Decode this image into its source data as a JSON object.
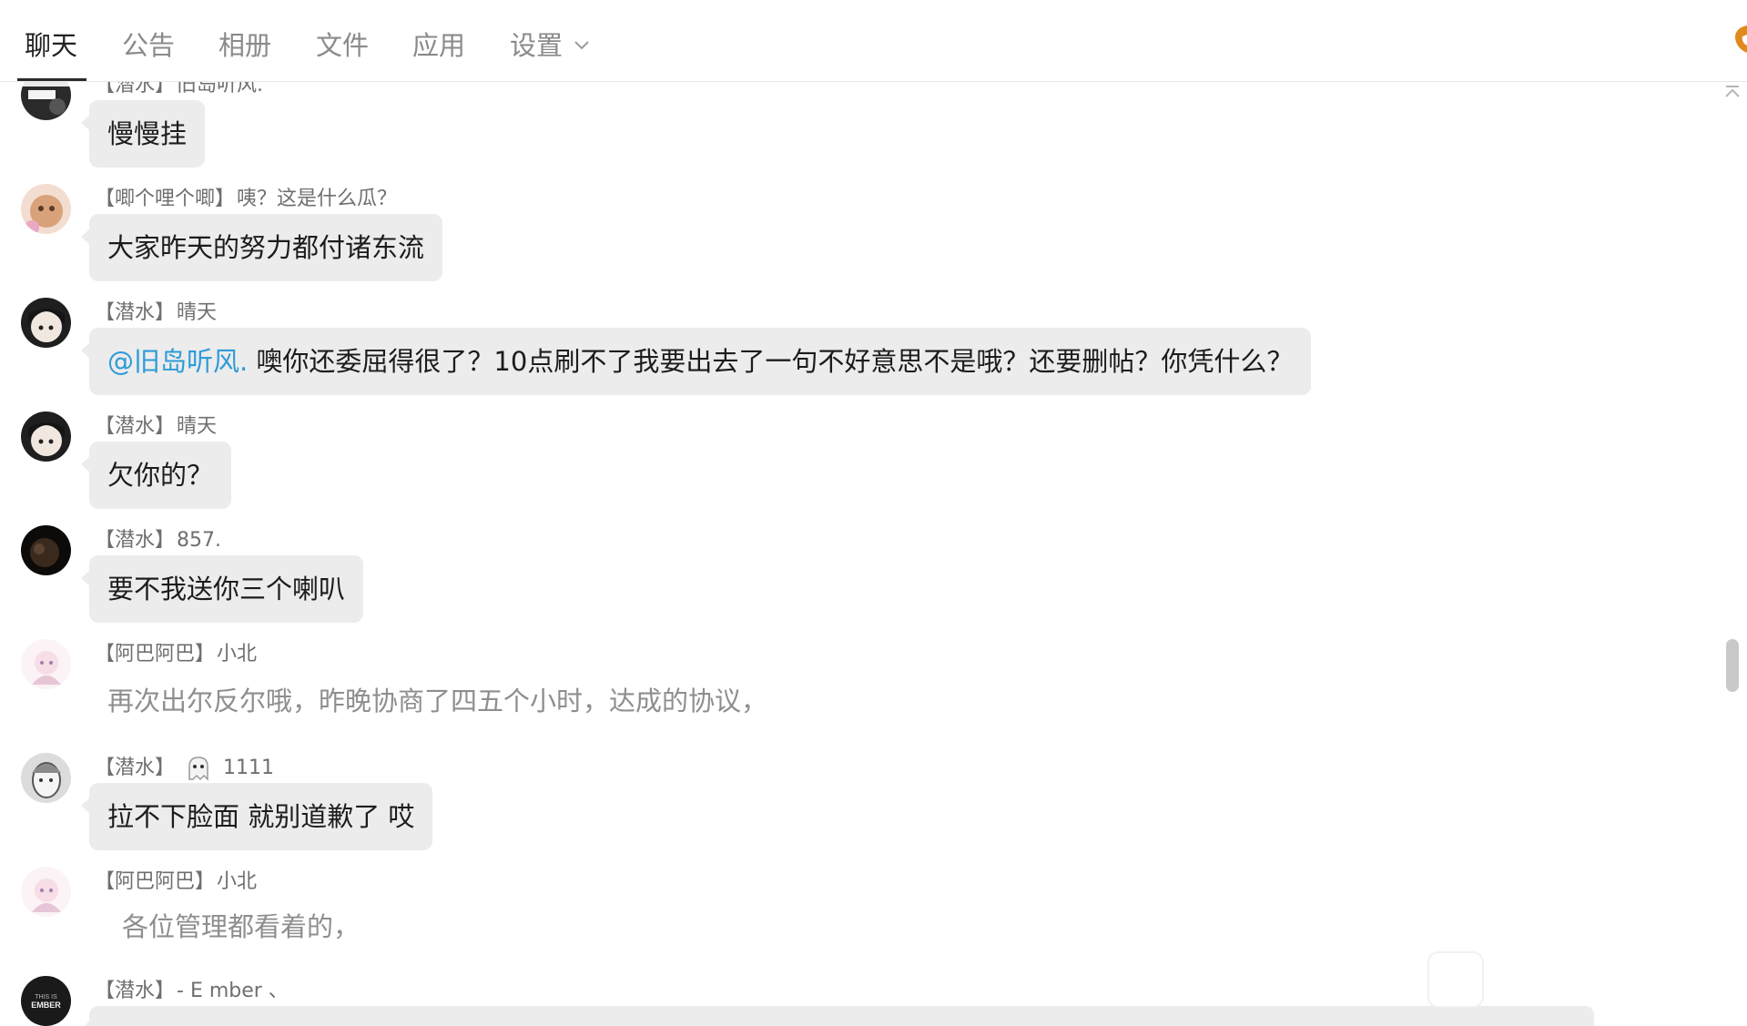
{
  "tabs": [
    {
      "label": "聊天",
      "active": true
    },
    {
      "label": "公告",
      "active": false
    },
    {
      "label": "相册",
      "active": false
    },
    {
      "label": "文件",
      "active": false
    },
    {
      "label": "应用",
      "active": false
    },
    {
      "label": "设置",
      "active": false
    }
  ],
  "colors": {
    "mention": "#2e9bd8",
    "bubble": "#ececec",
    "accent_phone": "#e08a1e"
  },
  "messages": [
    {
      "tag": "【潜水】",
      "name": "旧岛听风.",
      "text": "慢慢挂",
      "style": "bubble"
    },
    {
      "tag": "【唧个哩个唧】",
      "name": "咦？这是什么瓜？",
      "text": "大家昨天的努力都付诸东流",
      "style": "bubble"
    },
    {
      "tag": "【潜水】",
      "name": "晴天",
      "mention": "@旧岛听风.",
      "text": " 噢你还委屈得很了？10点刷不了我要出去了一句不好意思不是哦？还要删帖？你凭什么？",
      "style": "bubble"
    },
    {
      "tag": "【潜水】",
      "name": "晴天",
      "text": "欠你的？",
      "style": "bubble"
    },
    {
      "tag": "【潜水】",
      "name": "857.",
      "text": "要不我送你三个喇叭",
      "style": "bubble"
    },
    {
      "tag": "【阿巴阿巴】",
      "name": "小北",
      "text": "再次出尔反尔哦，昨晚协商了四五个小时，达成的协议，",
      "style": "plain"
    },
    {
      "tag": "【潜水】",
      "name": "1111",
      "text": "拉不下脸面 就别道歉了 哎",
      "style": "bubble"
    },
    {
      "tag": "【阿巴阿巴】",
      "name": "小北",
      "text": "各位管理都看着的，",
      "style": "plain"
    },
    {
      "tag": "【潜水】",
      "name": "- E mber 、",
      "text": "",
      "style": "bubble"
    }
  ],
  "avatars": {
    "ember_text_1": "THIS IS",
    "ember_text_2": "EMBER"
  }
}
